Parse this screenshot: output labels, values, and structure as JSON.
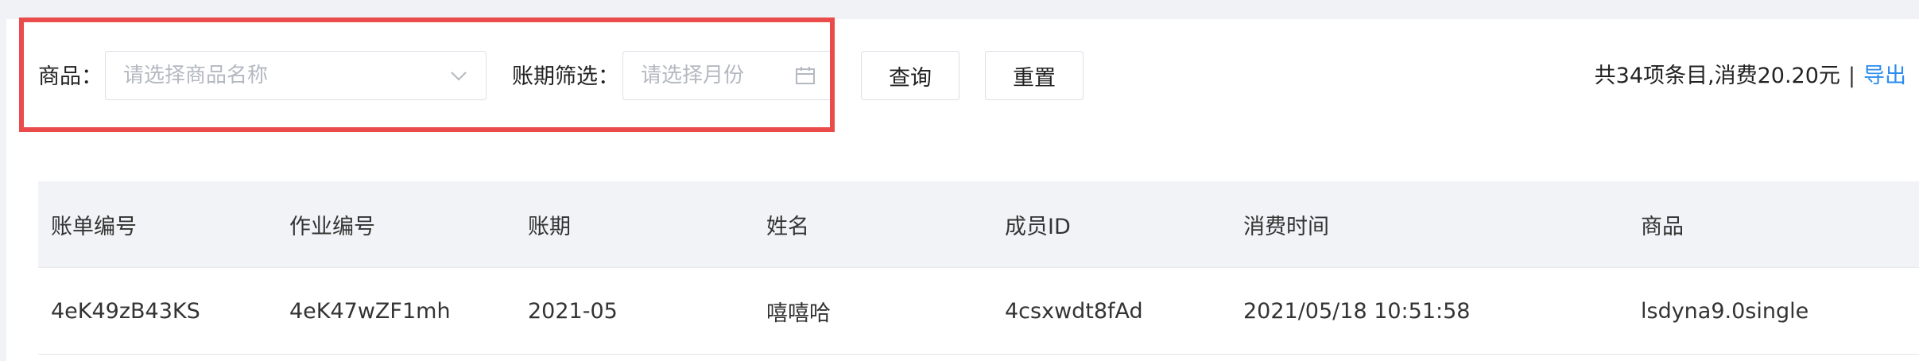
{
  "filters": {
    "product_label": "商品：",
    "product_placeholder": "请选择商品名称",
    "period_label": "账期筛选：",
    "period_placeholder": "请选择月份",
    "query_button": "查询",
    "reset_button": "重置"
  },
  "summary": {
    "text": "共34项条目,消费20.20元",
    "separator": "|",
    "export_link": "导出"
  },
  "table": {
    "columns": [
      "账单编号",
      "作业编号",
      "账期",
      "姓名",
      "成员ID",
      "消费时间",
      "商品"
    ],
    "rows": [
      [
        "4eK49zB43KS",
        "4eK47wZF1mh",
        "2021-05",
        "嘻嘻哈",
        "4csxwdt8fAd",
        "2021/05/18 10:51:58",
        "lsdyna9.0single"
      ]
    ]
  },
  "colors": {
    "highlight": "#ea4c4c",
    "link": "#2a8cf0"
  },
  "icons": {
    "product_select": "chevron-down-icon",
    "period_select": "calendar-icon"
  }
}
